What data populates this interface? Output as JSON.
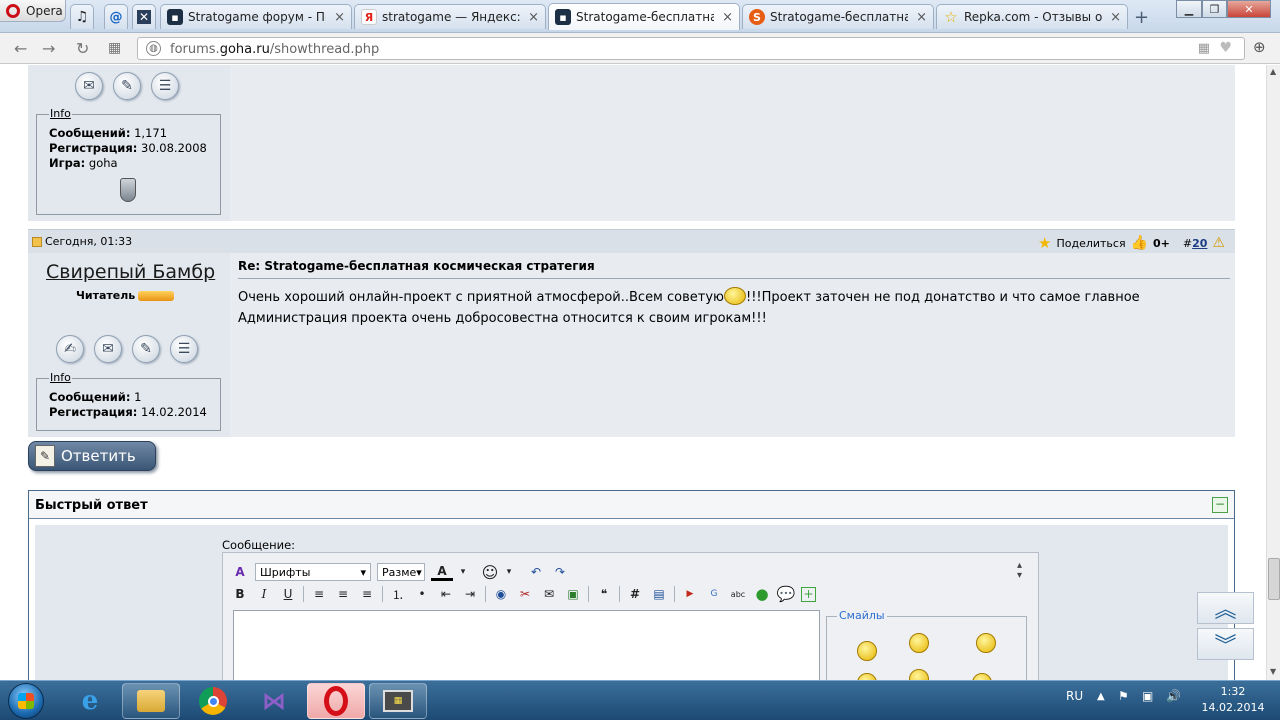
{
  "browser": {
    "menu_label": "Opera",
    "tabs": [
      {
        "title": "Stratogame форум - Проф",
        "favicon": "goha-favicon"
      },
      {
        "title": "stratogame — Яндекс: на",
        "favicon": "yandex-favicon"
      },
      {
        "title": "Stratogame-бесплатная к",
        "favicon": "goha-favicon",
        "active": true
      },
      {
        "title": "Stratogame-бесплатная к",
        "favicon": "stratogame-favicon"
      },
      {
        "title": "Repka.com - Отзывы о са",
        "favicon": "star-favicon"
      }
    ],
    "url_prefix": "forums.",
    "url_domain": "goha.ru",
    "url_path": "/showthread.php"
  },
  "prev_post": {
    "info_label": "Info",
    "stats": [
      {
        "key": "Сообщений:",
        "value": "1,171"
      },
      {
        "key": "Регистрация:",
        "value": "30.08.2008"
      },
      {
        "key": "Игра:",
        "value": "goha"
      }
    ]
  },
  "post": {
    "date": "Сегодня, 01:33",
    "share_label": "Поделиться",
    "rating": "0+",
    "number_prefix": "#",
    "number": "20",
    "username": "Свирепый Бамбр",
    "rank": "Читатель",
    "info_label": "Info",
    "stats": [
      {
        "key": "Сообщений:",
        "value": "1"
      },
      {
        "key": "Регистрация:",
        "value": "14.02.2014"
      }
    ],
    "title": "Re: Stratogame-бесплатная космическая стратегия",
    "body_part1": "Очень хороший онлайн-проект с приятной атмосферой..Всем советую",
    "body_part2": "!!!Проект заточен не под донатство и что самое главное",
    "body_part3": "Администрация проекта очень добросовестна относится к своим игрокам!!!"
  },
  "reply_button": "Ответить",
  "quick_reply": {
    "title": "Быстрый ответ",
    "message_label": "Сообщение:",
    "font_select": "Шрифты",
    "size_select": "Разме",
    "smileys_label": "Смайлы"
  },
  "taskbar": {
    "lang": "RU",
    "time": "1:32",
    "date": "14.02.2014"
  },
  "colors": {
    "forum_bg": "#e3e8ee",
    "link": "#1c3c83",
    "quick_reply_border": "#4a6a8a",
    "taskbar": "#1c4a74"
  }
}
